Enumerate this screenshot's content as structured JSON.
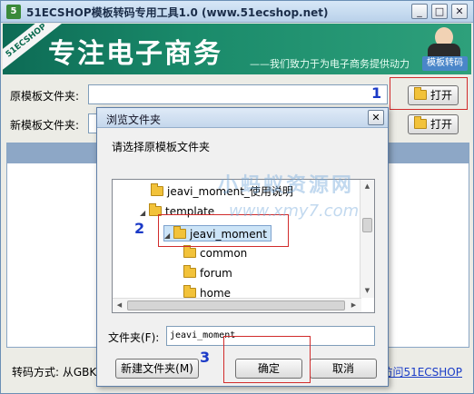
{
  "window": {
    "title": "51ECSHOP模板转码专用工具1.0  (www.51ecshop.net)",
    "icon": "app-icon",
    "controls": [
      "_",
      "□",
      "✕"
    ]
  },
  "banner": {
    "ribbon": "51ECSHOP",
    "title": "专注电子商务",
    "slogan": "——我们致力于为电子商务提供动力",
    "badge": "模板转码"
  },
  "main": {
    "source_label": "原模板文件夹:",
    "target_label": "新模板文件夹:",
    "open_label": "打开",
    "bottom_label": "转码方式:",
    "bottom_value": "从GBK",
    "bottom_link": "访问51ECSHOP"
  },
  "annotations": [
    "1",
    "2",
    "3"
  ],
  "dialog": {
    "title": "浏览文件夹",
    "close": "✕",
    "prompt": "请选择原模板文件夹",
    "tree": [
      {
        "label": "jeavi_moment_使用说明",
        "exp": ""
      },
      {
        "label": "template",
        "exp": "◢"
      },
      {
        "label": "jeavi_moment",
        "exp": "◢"
      },
      {
        "label": "common",
        "exp": ""
      },
      {
        "label": "forum",
        "exp": ""
      },
      {
        "label": "home",
        "exp": ""
      }
    ],
    "folder_label": "文件夹(F):",
    "folder_value": "jeavi_moment",
    "new_folder_label": "新建文件夹(M)",
    "ok_label": "确定",
    "cancel_label": "取消"
  },
  "watermark": {
    "line1": "小蚂蚁资源网",
    "line2": "www.xmy7.com"
  },
  "colors": {
    "accent_red": "#d12b2b",
    "annotation_blue": "#1b3ac7",
    "banner_green": "#1a8a6a"
  }
}
